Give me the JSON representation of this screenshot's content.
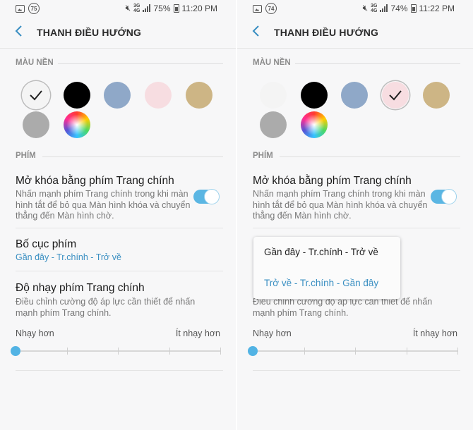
{
  "screens": [
    {
      "status": {
        "badge": "75",
        "network": "3G\n4G",
        "battery": "75%",
        "time": "11:20 PM"
      },
      "header": {
        "title": "THANH ĐIỀU HƯỚNG"
      },
      "background_section": {
        "label": "MÀU NỀN",
        "selected_index": 0
      },
      "keys_section": {
        "label": "PHÍM"
      },
      "unlock_item": {
        "title": "Mở khóa bằng phím Trang chính",
        "subtitle": "Nhấn mạnh phím Trang chính trong khi màn hình tắt để bỏ qua Màn hình khóa và chuyển thẳng đến Màn hình chờ.",
        "toggle_on": true
      },
      "layout_item": {
        "title": "Bố cục phím",
        "value": "Gần đây - Tr.chính - Trở về"
      },
      "sensitivity_item": {
        "title": "Độ nhạy phím Trang chính",
        "subtitle": "Điều chỉnh cường độ áp lực cần thiết để nhấn mạnh phím Trang chính.",
        "min_label": "Nhạy hơn",
        "max_label": "Ít nhạy hơn",
        "level": 0
      }
    },
    {
      "status": {
        "badge": "74",
        "network": "3G\n4G",
        "battery": "74%",
        "time": "11:22 PM"
      },
      "header": {
        "title": "THANH ĐIỀU HƯỚNG"
      },
      "background_section": {
        "label": "MÀU NỀN",
        "selected_index": 3
      },
      "keys_section": {
        "label": "PHÍM"
      },
      "unlock_item": {
        "title": "Mở khóa bằng phím Trang chính",
        "subtitle": "Nhấn mạnh phím Trang chính trong khi màn hình tắt để bỏ qua Màn hình khóa và chuyển thẳng đến Màn hình chờ.",
        "toggle_on": true
      },
      "sensitivity_item": {
        "subtitle": "Điều chỉnh cường độ áp lực cần thiết để nhấn mạnh phím Trang chính.",
        "min_label": "Nhạy hơn",
        "max_label": "Ít nhạy hơn",
        "level": 0
      },
      "layout_popup": {
        "options": [
          "Gần đây - Tr.chính - Trở về",
          "Trở về - Tr.chính - Gần đây"
        ],
        "highlighted_index": 1
      }
    }
  ],
  "swatch_colors": [
    "#f4f4f4",
    "#000000",
    "#8fa8c8",
    "#f7dde1",
    "#cdb585",
    "#ababab",
    "rainbow"
  ],
  "colors": {
    "accent": "#3a8fc2",
    "toggle": "#5bb6e3",
    "slider": "#52b3e4",
    "screen_bg": "#f7f7f8"
  },
  "icons": {
    "back": "chevron-left-icon",
    "check": "checkmark-icon",
    "gallery": "image-icon",
    "mute": "mute-icon",
    "signal": "signal-bars-icon",
    "battery": "battery-icon"
  }
}
